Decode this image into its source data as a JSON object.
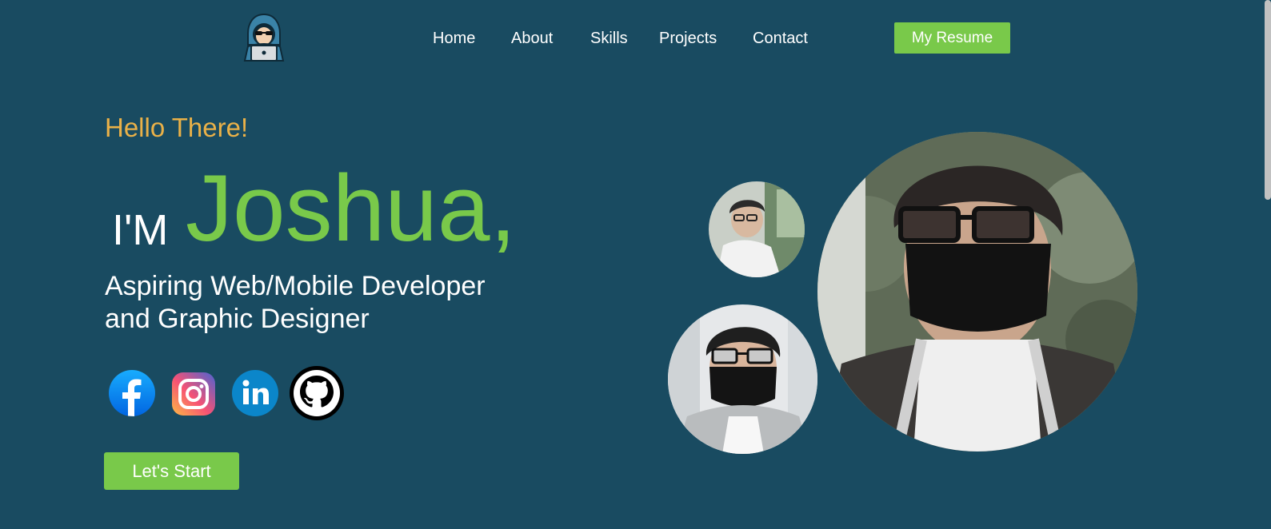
{
  "nav": {
    "logo_icon": "hooded-hacker-laptop-logo-icon",
    "items": [
      {
        "label": "Home"
      },
      {
        "label": "About"
      },
      {
        "label": "Skills"
      },
      {
        "label": "Projects"
      },
      {
        "label": "Contact"
      }
    ],
    "resume_label": "My Resume"
  },
  "hero": {
    "greeting": "Hello There!",
    "intro": "I'M",
    "name": "Joshua,",
    "tagline_line1": "Aspiring Web/Mobile Developer",
    "tagline_line2": "and Graphic Designer",
    "cta_label": "Let's Start"
  },
  "social": [
    {
      "icon": "facebook-icon"
    },
    {
      "icon": "instagram-icon"
    },
    {
      "icon": "linkedin-icon"
    },
    {
      "icon": "github-icon"
    }
  ],
  "photos": [
    {
      "description_icon": "profile-photo-small"
    },
    {
      "description_icon": "profile-photo-medium"
    },
    {
      "description_icon": "profile-photo-large"
    }
  ],
  "colors": {
    "background": "#194b61",
    "accent_green": "#79c94a",
    "greeting_orange": "#eab148",
    "text_white": "#ffffff"
  }
}
